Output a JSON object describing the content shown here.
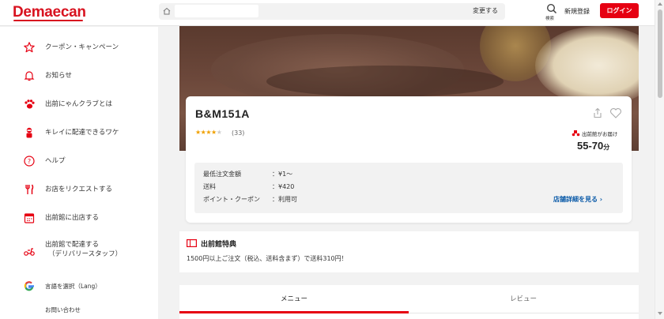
{
  "header": {
    "logo": "Demaecan",
    "change_label": "変更する",
    "search_label": "検索",
    "register_label": "新規登録",
    "login_label": "ログイン"
  },
  "sidebar": {
    "items": [
      {
        "label": "クーポン・キャンペーン",
        "icon": "star-icon"
      },
      {
        "label": "お知らせ",
        "icon": "bell-icon"
      },
      {
        "label": "出前にゃんクラブとは",
        "icon": "paw-icon"
      },
      {
        "label": "キレイに配達できるワケ",
        "icon": "delivery-person-icon"
      },
      {
        "label": "ヘルプ",
        "icon": "help-icon"
      },
      {
        "label": "お店をリクエストする",
        "icon": "fork-knife-icon"
      },
      {
        "label": "出前館に出店する",
        "icon": "calendar-icon"
      },
      {
        "label": "出前館で配達する",
        "label2": "（デリバリースタッフ）",
        "icon": "scooter-icon"
      },
      {
        "label": "言語を選択（Lang）",
        "icon": "google-icon"
      },
      {
        "label": "お問い合わせ",
        "icon": ""
      }
    ]
  },
  "store": {
    "name": "B&M151A",
    "stars": "★★★★★",
    "rating": 4,
    "rating_count": "(33)",
    "delivery_badge": "出前館がお届け",
    "delivery_time": "55-70",
    "delivery_time_unit": "分",
    "info": [
      {
        "label": "最低注文金額",
        "value": "：¥1～"
      },
      {
        "label": "送料",
        "value": "：¥420"
      },
      {
        "label": "ポイント・クーポン",
        "value": "：利用可"
      }
    ],
    "details_link": "店舗詳細を見る ›"
  },
  "privilege": {
    "title": "出前館特典",
    "text": "1500円以上ご注文（税込、送料含まず）で送料310円！"
  },
  "tabs": [
    {
      "label": "メニュー",
      "active": true
    },
    {
      "label": "レビュー",
      "active": false
    }
  ],
  "colors": {
    "brand_red": "#e60012",
    "link_blue": "#0a5aa8",
    "star": "#f0a000"
  }
}
